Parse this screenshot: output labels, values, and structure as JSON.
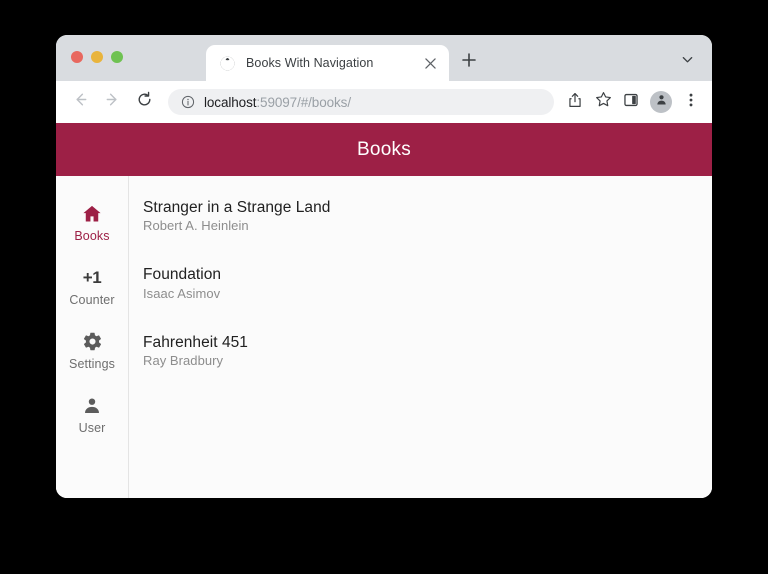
{
  "browser": {
    "traffic_lights": [
      {
        "name": "close-window-button",
        "color": "#e8685f"
      },
      {
        "name": "minimize-window-button",
        "color": "#e9b43c"
      },
      {
        "name": "maximize-window-button",
        "color": "#6fc252"
      }
    ],
    "tab": {
      "title": "Books With Navigation",
      "favicon": "globe-icon",
      "close_icon": "close-icon"
    },
    "new_tab_icon": "plus-icon",
    "tab_search_icon": "chevron-down-icon",
    "nav": {
      "back_icon": "arrow-left-icon",
      "forward_icon": "arrow-right-icon",
      "reload_icon": "reload-icon"
    },
    "omnibox": {
      "info_icon": "info-circle-icon",
      "host": "localhost",
      "path": ":59097/#/books/",
      "full_url": "localhost:59097/#/books/"
    },
    "toolbar_icons": [
      {
        "name": "share-icon"
      },
      {
        "name": "bookmark-star-icon"
      },
      {
        "name": "side-panel-icon"
      },
      {
        "name": "profile-avatar-icon"
      },
      {
        "name": "more-options-icon"
      }
    ]
  },
  "app": {
    "accent_color": "#9d2046",
    "header": {
      "title": "Books"
    },
    "nav_rail": {
      "items": [
        {
          "label": "Books",
          "icon": "home-icon",
          "active": true
        },
        {
          "label": "Counter",
          "icon": "plus-one-icon",
          "glyph": "+1",
          "active": false
        },
        {
          "label": "Settings",
          "icon": "gear-icon",
          "active": false
        },
        {
          "label": "User",
          "icon": "person-icon",
          "active": false
        }
      ]
    },
    "books": [
      {
        "title": "Stranger in a Strange Land",
        "author": "Robert A. Heinlein"
      },
      {
        "title": "Foundation",
        "author": "Isaac Asimov"
      },
      {
        "title": "Fahrenheit 451",
        "author": "Ray Bradbury"
      }
    ]
  }
}
